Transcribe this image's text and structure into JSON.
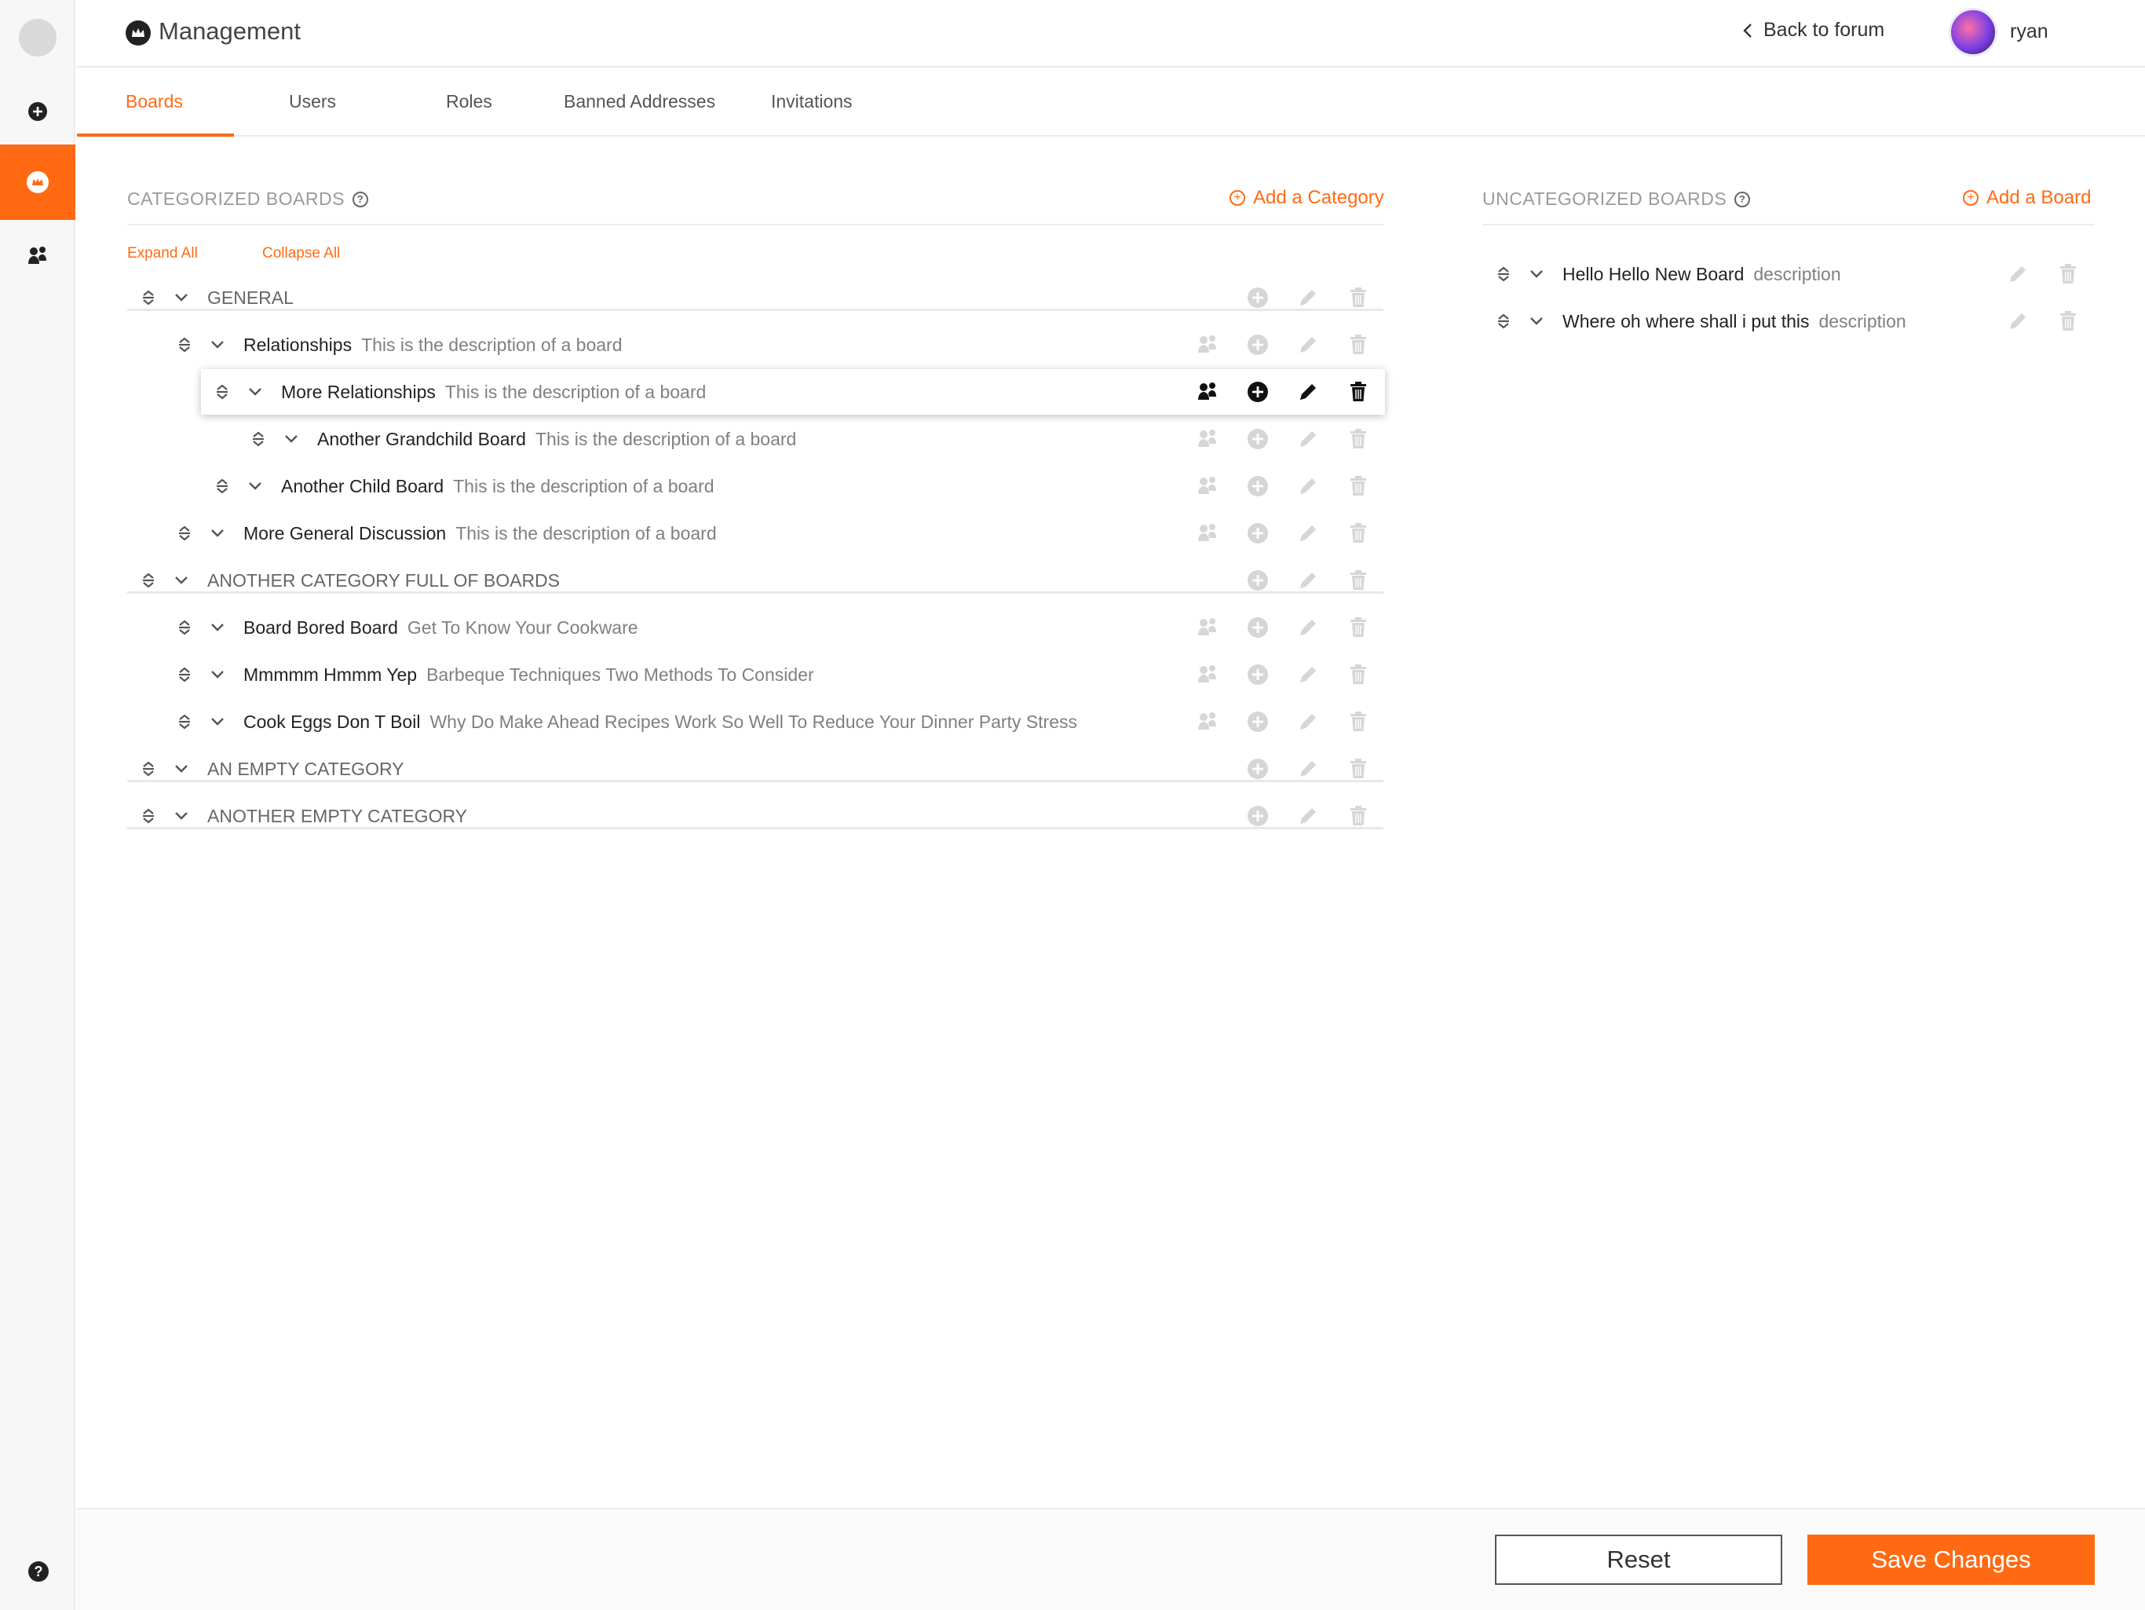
{
  "header": {
    "title": "Management",
    "back_label": "Back to forum",
    "username": "ryan"
  },
  "tabs": [
    {
      "label": "Boards",
      "active": true
    },
    {
      "label": "Users"
    },
    {
      "label": "Roles"
    },
    {
      "label": "Banned Addresses"
    },
    {
      "label": "Invitations"
    }
  ],
  "categorized": {
    "title": "CATEGORIZED BOARDS",
    "add_label": "Add a Category",
    "expand_label": "Expand All",
    "collapse_label": "Collapse All",
    "rows": [
      {
        "type": "category",
        "name": "GENERAL",
        "desc": ""
      },
      {
        "type": "board",
        "name": "Relationships",
        "desc": "This is the  description of a board"
      },
      {
        "type": "board",
        "name": "More Relationships",
        "desc": "This is the  description of a board",
        "highlighted": true
      },
      {
        "type": "board",
        "name": "Another Grandchild Board",
        "desc": "This is the  description of a board"
      },
      {
        "type": "board",
        "name": "Another Child Board",
        "desc": "This is the  description of a board"
      },
      {
        "type": "board",
        "name": "More General Discussion",
        "desc": "This is the  description of a board"
      },
      {
        "type": "category",
        "name": "ANOTHER CATEGORY FULL OF BOARDS",
        "desc": ""
      },
      {
        "type": "board",
        "name": "Board Bored Board",
        "desc": "Get To Know Your Cookware"
      },
      {
        "type": "board",
        "name": "Mmmmm Hmmm Yep",
        "desc": "Barbeque Techniques Two Methods To Consider"
      },
      {
        "type": "board",
        "name": "Cook Eggs Don T Boil",
        "desc": "Why Do Make Ahead Recipes Work So Well To Reduce Your Dinner Party Stress"
      },
      {
        "type": "category",
        "name": "AN EMPTY CATEGORY",
        "desc": ""
      },
      {
        "type": "category",
        "name": "ANOTHER EMPTY CATEGORY",
        "desc": ""
      }
    ]
  },
  "uncategorized": {
    "title": "UNCATEGORIZED BOARDS",
    "add_label": "Add a Board",
    "rows": [
      {
        "name": "Hello Hello New Board",
        "desc": "description"
      },
      {
        "name": "Where oh where shall i put this",
        "desc": "description"
      }
    ]
  },
  "footer": {
    "reset_label": "Reset",
    "save_label": "Save Changes"
  },
  "colors": {
    "accent": "#ff6a13",
    "muted_icon": "#d6d6d6",
    "active_icon": "#111111"
  },
  "icons": [
    "moderators-icon",
    "add-circle-icon",
    "pencil-icon",
    "trash-icon",
    "drag-handle-icon",
    "chevron-down-icon",
    "crown-icon",
    "question-icon"
  ]
}
